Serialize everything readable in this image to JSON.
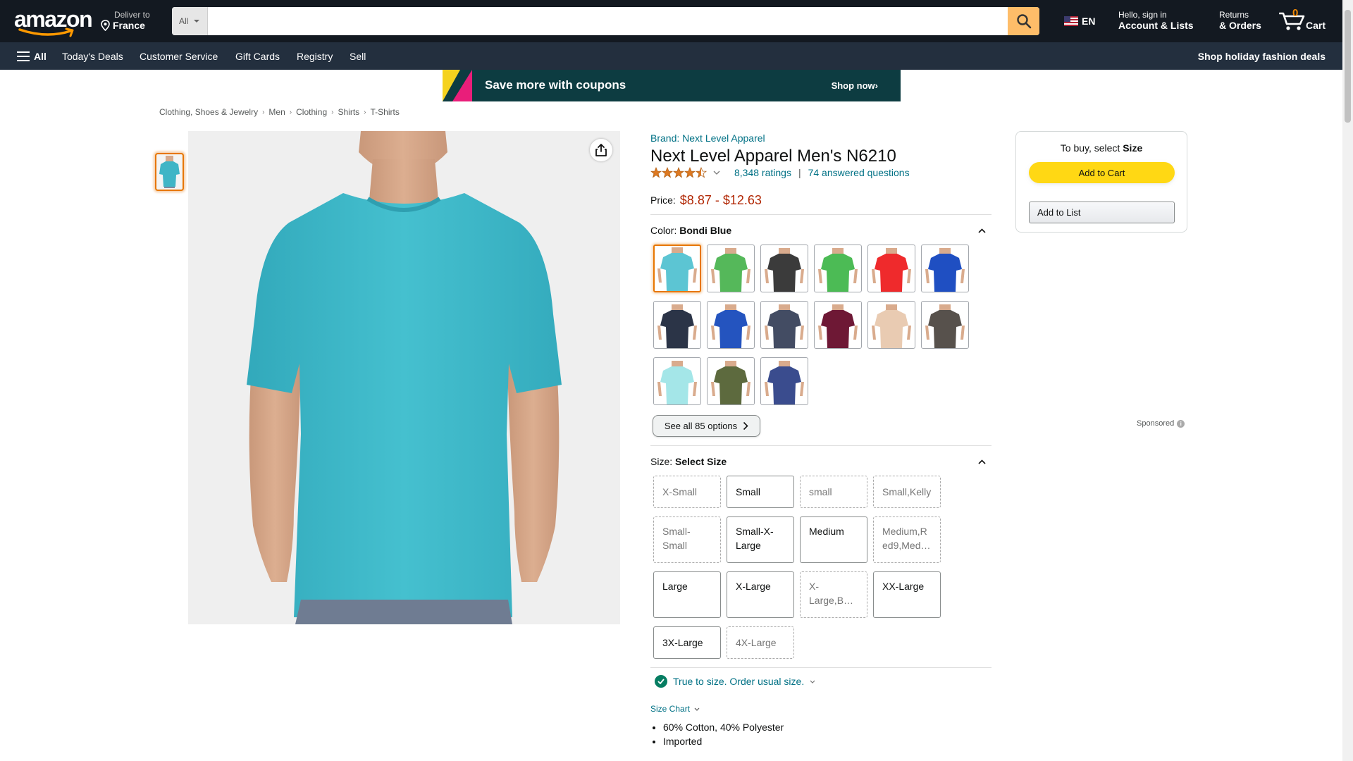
{
  "header": {
    "logo": "amazon",
    "deliver_label": "Deliver to",
    "deliver_location": "France",
    "search_category": "All",
    "search_placeholder": "",
    "language": "EN",
    "account_greeting": "Hello, sign in",
    "account_label": "Account & Lists",
    "returns_label": "Returns",
    "orders_label": "& Orders",
    "cart_count": "0",
    "cart_label": "Cart"
  },
  "subnav": {
    "all_label": "All",
    "items": [
      "Today's Deals",
      "Customer Service",
      "Gift Cards",
      "Registry",
      "Sell"
    ],
    "promo": "Shop holiday fashion deals"
  },
  "banner": {
    "text": "Save more with coupons",
    "cta": "Shop now›"
  },
  "breadcrumb": [
    "Clothing, Shoes & Jewelry",
    "Men",
    "Clothing",
    "Shirts",
    "T-Shirts"
  ],
  "product": {
    "brand": "Brand: Next Level Apparel",
    "title": "Next Level Apparel Men's N6210",
    "rating_stars": 4.5,
    "ratings_count": "8,348 ratings",
    "separator": "|",
    "answered": "74 answered questions",
    "price_label": "Price:",
    "price": "$8.87 - $12.63",
    "color_label": "Color:",
    "color_value": "Bondi Blue",
    "colors": [
      "#5cc5d3",
      "#55b85a",
      "#3b3b3b",
      "#4cbb55",
      "#ef2a2c",
      "#1f4fc2",
      "#2b3447",
      "#2454bf",
      "#434c63",
      "#6e1835",
      "#e9cbb2",
      "#57514c",
      "#a4e6e8",
      "#5d6a3e",
      "#3a4c8e"
    ],
    "selected_color_index": 0,
    "see_all": "See all 85 options",
    "size_label": "Size:",
    "size_value": "Select Size",
    "sizes": [
      {
        "label": "X-Small",
        "available": false
      },
      {
        "label": "Small",
        "available": true
      },
      {
        "label": "small",
        "available": false
      },
      {
        "label": "Small,Kelly",
        "available": false
      },
      {
        "label": "Small-Small",
        "available": false
      },
      {
        "label": "Small-X-Large",
        "available": true
      },
      {
        "label": "Medium",
        "available": true
      },
      {
        "label": "Medium,Red9,Med…",
        "available": false
      },
      {
        "label": "Large",
        "available": true
      },
      {
        "label": "X-Large",
        "available": true
      },
      {
        "label": "X-Large,B…",
        "available": false
      },
      {
        "label": "XX-Large",
        "available": true
      },
      {
        "label": "3X-Large",
        "available": true
      },
      {
        "label": "4X-Large",
        "available": false
      }
    ],
    "fit_text": "True to size. Order usual size.",
    "size_chart": "Size Chart",
    "bullets": [
      "60% Cotton, 40% Polyester",
      "Imported"
    ]
  },
  "buybox": {
    "note_prefix": "To buy, select ",
    "note_bold": "Size",
    "add_to_cart": "Add to Cart",
    "add_to_list": "Add to List"
  },
  "sponsored": "Sponsored",
  "colors": {
    "nav_bg": "#131921",
    "subnav_bg": "#232f3e",
    "search_button": "#febd69",
    "link": "#007185",
    "price": "#b12704",
    "cart_button": "#ffd814",
    "selected_border": "#e77600"
  }
}
